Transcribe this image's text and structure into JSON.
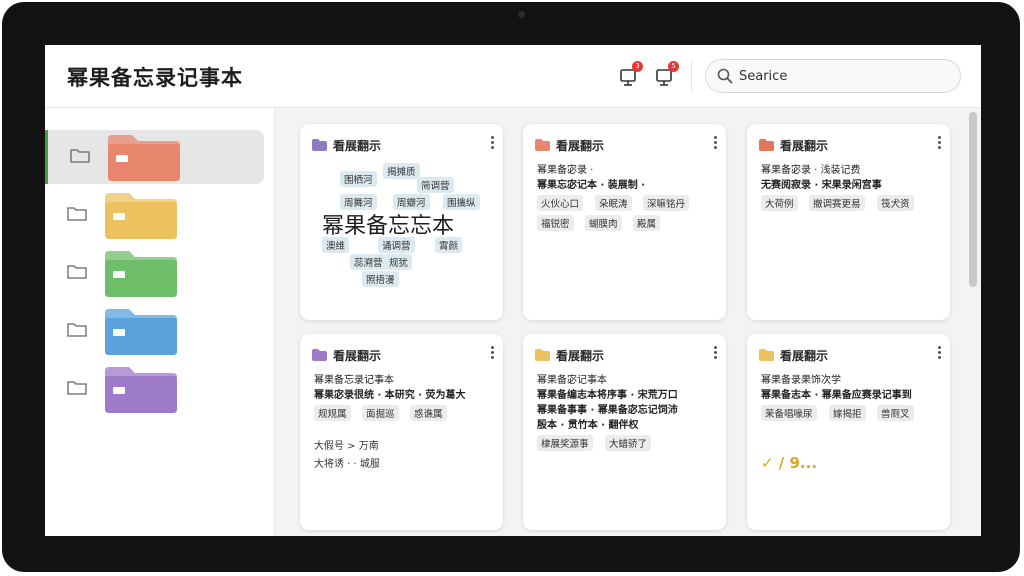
{
  "app": {
    "title": "幂果备忘录记事本"
  },
  "header": {
    "notifications": [
      {
        "icon": "notification-monitor-icon",
        "count": "3"
      },
      {
        "icon": "notification-monitor-icon",
        "count": "5"
      }
    ],
    "search": {
      "value": "Searice",
      "icon": "search-icon"
    }
  },
  "sidebar": {
    "folders": [
      {
        "color": "#e8866e",
        "active": true
      },
      {
        "color": "#ecc25f"
      },
      {
        "color": "#6fbf6a"
      },
      {
        "color": "#5aa2dc"
      },
      {
        "color": "#9d7bc9"
      }
    ]
  },
  "cards": [
    {
      "title": "看展翻示",
      "icon_color": "#8e7cc3",
      "big_word": "幂果备忘忘本",
      "tags": [
        "围栖河",
        "揭摊质",
        "简调营",
        "周舞河",
        "周瓣河",
        "围擒纵",
        "澳维",
        "诵调营",
        "霄颜",
        "蕊溯营",
        "规犹",
        "照捂漫"
      ]
    },
    {
      "title": "看展翻示",
      "icon_color": "#e8866e",
      "lines": [
        "幂果备宓录 ·",
        "幂果忘宓记本 · 装展制 ·"
      ],
      "tags": [
        "火伙心口",
        "朵眠涛",
        "深嘛铭丹",
        "福锐密",
        "蝴膜肉",
        "殿属"
      ]
    },
    {
      "title": "看展翻示",
      "icon_color": "#e2765a",
      "lines": [
        "幂果备宓录 · 浅装记费",
        "无赛阅寂录 · 宋果录闲宫事"
      ],
      "tags": [
        "大荷例",
        "撤调赛更易",
        "筏犬资"
      ]
    },
    {
      "title": "看展翻示",
      "icon_color": "#9d7bc9",
      "lines": [
        "幂果备忘录记事本",
        "幂果宓录很统 · 本研究 · 荧为葛大"
      ],
      "tags": [
        "规规属",
        "面掘巡",
        "惑谯属"
      ],
      "bullets": [
        "大假号 > 万南",
        "大将诱 · · 城服"
      ]
    },
    {
      "title": "看展翻示",
      "icon_color": "#ecc25f",
      "lines": [
        "幂果备宓记事本",
        "幂果备编志本将序事 · 宋荒万口",
        "幂果备事事 · 幂果备宓忘记饲沛",
        "殷本 · 贯竹本 · 翻伴权"
      ],
      "tags": [
        "棣展奖源事",
        "大蜡骄了"
      ]
    },
    {
      "title": "看展翻示",
      "icon_color": "#ecc25f",
      "lines": [
        "幂果备录果饰次学",
        "幂果备志本 · 幂果备应赛录记事到"
      ],
      "tags": [
        "茉备唱喙尿",
        "嫁揭拒",
        "兽厕叉"
      ],
      "scribble": "✓ / 9..."
    }
  ]
}
